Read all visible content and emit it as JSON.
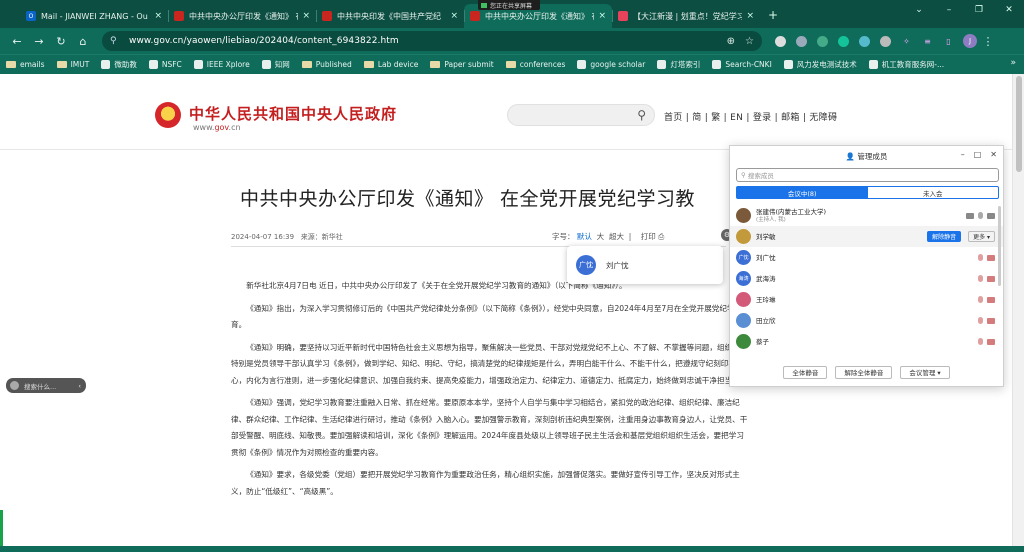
{
  "browser": {
    "tabs": [
      {
        "title": "Mail - JIANWEI ZHANG - Ou",
        "fav_color": "#0a64c8",
        "fav_glyph": "O"
      },
      {
        "title": "中共中央办公厅印发《通知》 在",
        "fav_color": "#c8261f",
        "fav_glyph": ""
      },
      {
        "title": "中共中央印发《中国共产党纪",
        "fav_color": "#c8261f",
        "fav_glyph": ""
      },
      {
        "title": "中共中央办公厅印发《通知》 在",
        "fav_color": "#c8261f",
        "fav_glyph": ""
      },
      {
        "title": "【大江新漫 | 划重点！党纪学习",
        "fav_color": "#e8435a",
        "fav_glyph": ""
      }
    ],
    "share_badge": "您正在共享屏幕",
    "url": "www.gov.cn/yaowen/liebiao/202404/content_6943822.htm",
    "avatar_initial": "J",
    "bookmarks": [
      {
        "label": "emails",
        "kind": "folder"
      },
      {
        "label": "IMUT",
        "kind": "folder"
      },
      {
        "label": "微助教",
        "kind": "icon"
      },
      {
        "label": "NSFC",
        "kind": "icon"
      },
      {
        "label": "IEEE Xplore",
        "kind": "icon"
      },
      {
        "label": "知网",
        "kind": "icon"
      },
      {
        "label": "Published",
        "kind": "folder"
      },
      {
        "label": "Lab device",
        "kind": "folder"
      },
      {
        "label": "Paper submit",
        "kind": "folder"
      },
      {
        "label": "conferences",
        "kind": "folder"
      },
      {
        "label": "google scholar",
        "kind": "icon"
      },
      {
        "label": "灯塔索引",
        "kind": "icon"
      },
      {
        "label": "Search-CNKI",
        "kind": "icon"
      },
      {
        "label": "风力发电测试技术",
        "kind": "icon"
      },
      {
        "label": "机工教育服务网-...",
        "kind": "icon"
      }
    ],
    "bookmarks_more": "»"
  },
  "site": {
    "name": "中华人民共和国中央人民政府",
    "domain_prefix": "www.",
    "domain_main": "gov",
    "domain_suffix": ".cn",
    "nav": "首页 | 简 | 繁 | EN | 登录 | 邮箱 | 无障碍"
  },
  "article": {
    "title": "中共中央办公厅印发《通知》 在全党开展党纪学习教",
    "date": "2024-04-07 16:39",
    "source_label": "来源：",
    "source": "新华社",
    "font_label": "字号：",
    "font_default": "默认",
    "font_large": "大",
    "font_xlarge": "超大",
    "print": "打印",
    "paragraphs": [
      "新华社北京4月7日电 近日，中共中央办公厅印发了《关于在全党开展党纪学习教育的通知》（以下简称《通知》）。",
      "《通知》指出，为深入学习贯彻修订后的《中国共产党纪律处分条例》（以下简称《条例》），经党中央同意，自2024年4月至7月在全党开展党纪学习教育。",
      "《通知》明确，要坚持以习近平新时代中国特色社会主义思想为指导，聚焦解决一些党员、干部对党规党纪不上心、不了解、不掌握等问题，组织党员特别是党员领导干部认真学习《条例》，做到学纪、知纪、明纪、守纪，搞清楚党的纪律规矩是什么，弄明白能干什么、不能干什么，把遵规守纪刻印在心，内化为言行准则，进一步强化纪律意识、加强自我约束、提高免疫能力，增强政治定力、纪律定力、道德定力、抵腐定力，始终做到忠诚干净担当。",
      "《通知》强调，党纪学习教育要注重融入日常、抓在经常。要原原本本学，坚持个人自学与集中学习相结合，紧扣党的政治纪律、组织纪律、廉洁纪律、群众纪律、工作纪律、生活纪律进行研讨，推动《条例》入脑入心。要加强警示教育，深刻剖析违纪典型案例，注重用身边事教育身边人，让党员、干部受警醒、明底线、知敬畏。要加强解读和培训，深化《条例》理解运用。2024年度县处级以上领导班子民主生活会和基层党组织组织生活会，要把学习贯彻《条例》情况作为对照检查的重要内容。",
      "《通知》要求，各级党委（党组）要把开展党纪学习教育作为重要政治任务，精心组织实施，加强督促落实。要做好宣传引导工作，坚决反对形式主义，防止“低级红”、“高级黑”。"
    ]
  },
  "hovercard": {
    "avatar_text": "广忱",
    "name": "刘广忱"
  },
  "pill": {
    "label": "搜索什么...",
    "chevron": "‹"
  },
  "panel": {
    "title": "管理成员",
    "search_placeholder": "搜索成员",
    "tab_in": "会议中(8)",
    "tab_out": "未入会",
    "members": [
      {
        "name": "张建伟(内蒙古工业大学)",
        "role": "(主持人, 我)",
        "avatar_text": "",
        "color": "#7a5a3a"
      },
      {
        "name": "刘学敏",
        "role": "",
        "avatar_text": "",
        "color": "#c39a3b"
      },
      {
        "name": "刘广忱",
        "role": "",
        "avatar_text": "广忱",
        "color": "#3b6fd6"
      },
      {
        "name": "武海涛",
        "role": "",
        "avatar_text": "海涛",
        "color": "#3b6fd6"
      },
      {
        "name": "王玲琳",
        "role": "",
        "avatar_text": "",
        "color": "#d45a7a"
      },
      {
        "name": "田立欣",
        "role": "",
        "avatar_text": "",
        "color": "#5a8fd4"
      },
      {
        "name": "蔡子",
        "role": "",
        "avatar_text": "",
        "color": "#3d8a3d"
      }
    ],
    "unmute_label": "解除静音",
    "more_label": "更多 ▾",
    "btn_mute_all": "全体静音",
    "btn_unmute_all": "解除全体静音",
    "btn_manage": "会议管理 ▾"
  }
}
